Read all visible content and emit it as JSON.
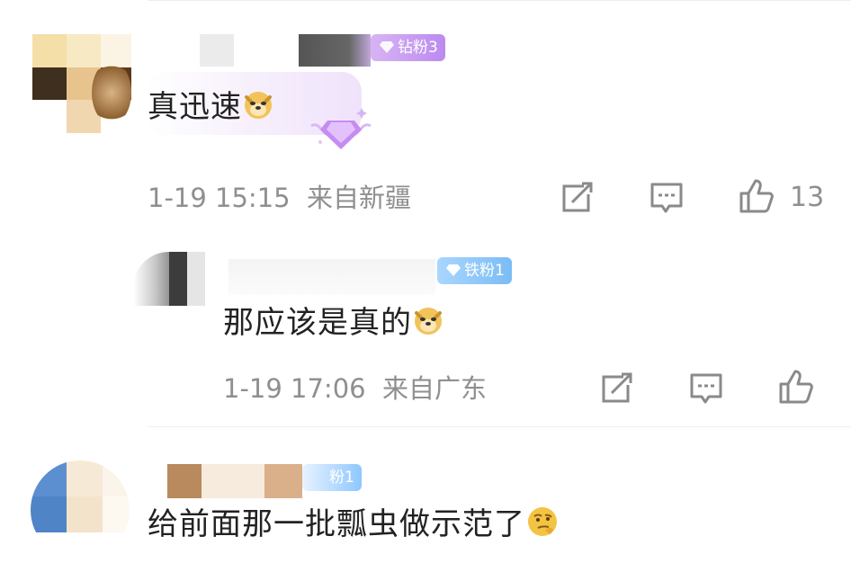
{
  "comments": [
    {
      "badge": "钻粉3",
      "text": "真迅速",
      "time": "1-19 15:15",
      "location": "来自新疆",
      "likes": "13",
      "emoji_icon": "doge-icon"
    },
    {
      "badge": "铁粉1",
      "text": "那应该是真的",
      "time": "1-19 17:06",
      "location": "来自广东",
      "emoji_icon": "doge-icon"
    },
    {
      "badge": "粉1",
      "text": "给前面那一批瓢虫做示范了",
      "emoji_icon": "thinking-face-icon"
    }
  ],
  "colors": {
    "diamond_badge": "#c89af0",
    "iron_badge": "#8ec7ff",
    "text": "#222222",
    "meta": "#8f8f8f"
  }
}
